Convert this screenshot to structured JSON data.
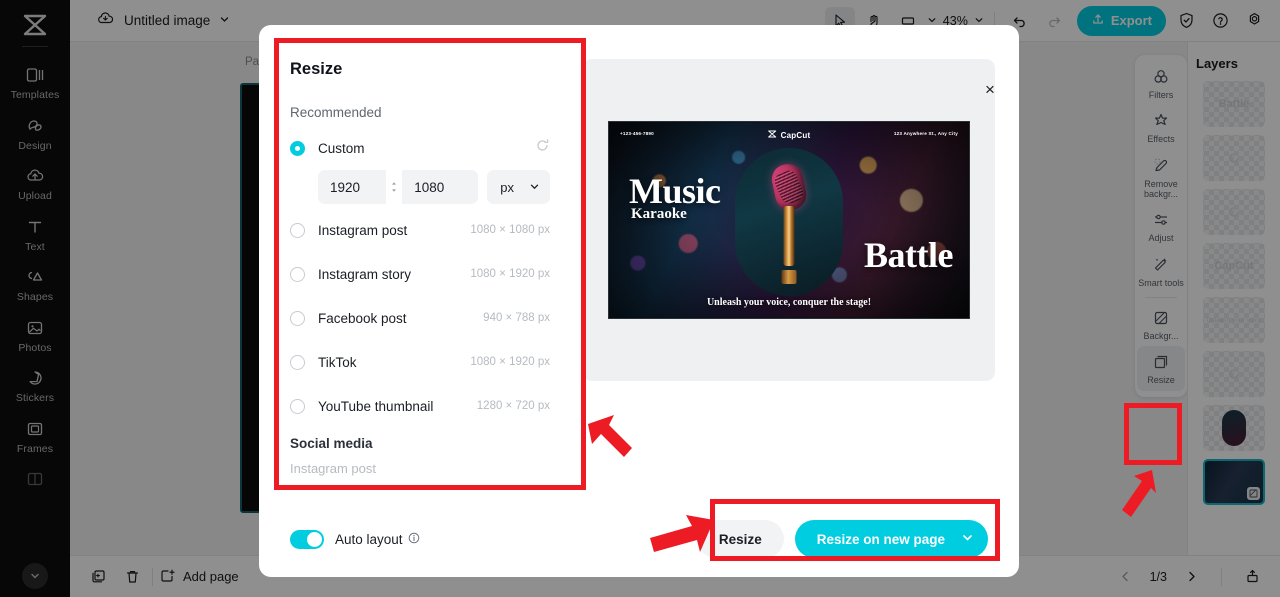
{
  "app": {
    "document_title": "Untitled image",
    "zoom_level": "43%",
    "export_label": "Export"
  },
  "sidebar": {
    "items": [
      {
        "label": "Templates",
        "icon": "templates-icon"
      },
      {
        "label": "Design",
        "icon": "design-icon"
      },
      {
        "label": "Upload",
        "icon": "upload-icon"
      },
      {
        "label": "Text",
        "icon": "text-icon"
      },
      {
        "label": "Shapes",
        "icon": "shapes-icon"
      },
      {
        "label": "Photos",
        "icon": "photos-icon"
      },
      {
        "label": "Stickers",
        "icon": "stickers-icon"
      },
      {
        "label": "Frames",
        "icon": "frames-icon"
      }
    ]
  },
  "canvas": {
    "page_label": "Page"
  },
  "right_tools": {
    "items": [
      {
        "label": "Filters",
        "icon": "filters-icon"
      },
      {
        "label": "Effects",
        "icon": "effects-icon"
      },
      {
        "label": "Remove backgr...",
        "icon": "remove-background-icon"
      },
      {
        "label": "Adjust",
        "icon": "adjust-icon"
      },
      {
        "label": "Smart tools",
        "icon": "smart-tools-icon"
      },
      {
        "label": "Backgr...",
        "icon": "background-icon"
      },
      {
        "label": "Resize",
        "icon": "resize-icon"
      }
    ]
  },
  "layers": {
    "title": "Layers",
    "items": [
      {
        "preview": "Battle"
      },
      {
        "preview": ""
      },
      {
        "preview": ""
      },
      {
        "preview": "CapCut"
      },
      {
        "preview": "Unleash your voice"
      },
      {
        "preview": ""
      },
      {
        "preview": ""
      },
      {
        "preview": ""
      }
    ]
  },
  "bottombar": {
    "add_page_label": "Add page",
    "page_indicator": "1/3"
  },
  "modal": {
    "title": "Resize",
    "section_recommended": "Recommended",
    "section_social": "Social media",
    "close_label": "×",
    "custom": {
      "label": "Custom",
      "width": "1920",
      "height": "1080",
      "unit": "px",
      "selected": true
    },
    "presets": [
      {
        "label": "Instagram post",
        "dimensions": "1080 × 1080 px"
      },
      {
        "label": "Instagram story",
        "dimensions": "1080 × 1920 px"
      },
      {
        "label": "Facebook post",
        "dimensions": "940 × 788 px"
      },
      {
        "label": "TikTok",
        "dimensions": "1080 × 1920 px"
      },
      {
        "label": "YouTube thumbnail",
        "dimensions": "1280 × 720 px"
      }
    ],
    "social_items": [
      {
        "label": "Instagram post"
      }
    ],
    "auto_layout_label": "Auto layout",
    "buttons": {
      "resize": "Resize",
      "resize_new_page": "Resize on new page"
    }
  },
  "poster": {
    "phone": "+123-456-7890",
    "brand": "CapCut",
    "address": "123 Anywhere St., Any City",
    "headline": "Music",
    "subhead": "Karaoke",
    "headline2": "Battle",
    "tagline": "Unleash your voice, conquer the stage!"
  },
  "colors": {
    "accent": "#00cde0",
    "annotation": "#ed1c24",
    "selection": "#14b8c8"
  }
}
